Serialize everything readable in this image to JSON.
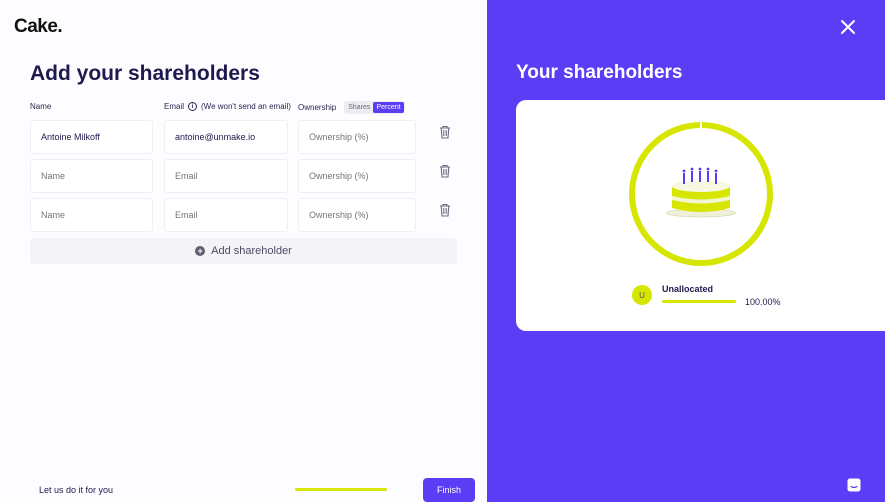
{
  "brand": {
    "logo": "Cake."
  },
  "form": {
    "title": "Add your shareholders",
    "columns": {
      "name": "Name",
      "email": "Email",
      "email_info": "i",
      "email_note": "(We won't send an email)",
      "ownership": "Ownership",
      "toggle_shares": "Shares",
      "toggle_percent": "Percent"
    },
    "rows": [
      {
        "name": "Antoine Milkoff",
        "email": "antoine@unmake.io",
        "ownership": "",
        "name_ph": "Name",
        "email_ph": "Email",
        "ownership_ph": "Ownership (%)"
      },
      {
        "name": "",
        "email": "",
        "ownership": "",
        "name_ph": "Name",
        "email_ph": "Email",
        "ownership_ph": "Ownership (%)"
      },
      {
        "name": "",
        "email": "",
        "ownership": "",
        "name_ph": "Name",
        "email_ph": "Email",
        "ownership_ph": "Ownership (%)"
      }
    ],
    "add_label": "Add shareholder",
    "add_icon": "+"
  },
  "footer": {
    "help_link": "Let us do it for you",
    "progress": 1.0,
    "finish_label": "Finish"
  },
  "summary": {
    "title": "Your shareholders",
    "legend": [
      {
        "initial": "U",
        "label": "Unallocated",
        "percent": "100.00%"
      }
    ]
  },
  "colors": {
    "accent": "#5b3df5",
    "lime": "#d6e600"
  }
}
